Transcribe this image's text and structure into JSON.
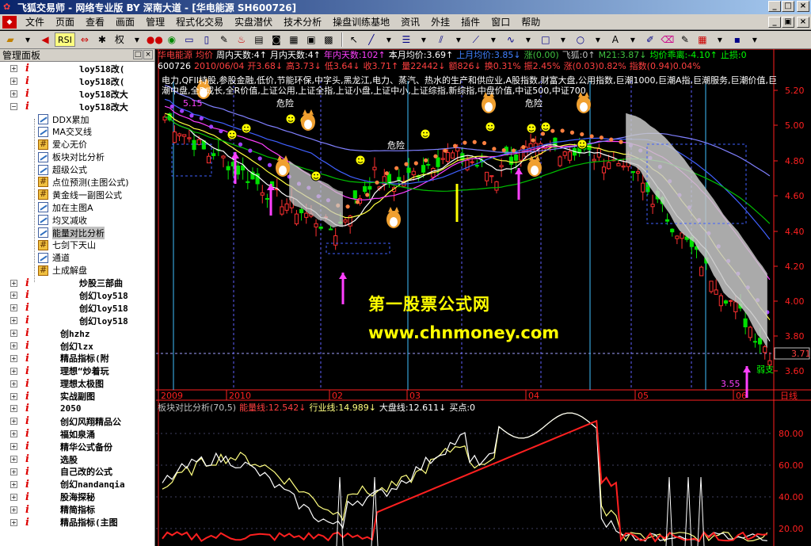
{
  "titlebar": {
    "title": "飞狐交易师 - 网络专业版 BY 深南大道 - [华电能源 SH600726]",
    "min": "_",
    "max": "□",
    "close": "×",
    "inner_min": "_",
    "inner_max": "▣",
    "inner_close": "×"
  },
  "menu": [
    "文件",
    "页面",
    "查看",
    "画面",
    "管理",
    "程式化交易",
    "实盘潜伏",
    "技术分析",
    "操盘训练基地",
    "资讯",
    "外挂",
    "插件",
    "窗口",
    "帮助"
  ],
  "toolbar": {
    "rsi_label": "RSI",
    "quan_label": "权"
  },
  "panel": {
    "title": "管理面板",
    "tree": [
      {
        "type": "folder",
        "label": "loy518改(",
        "expander": "+"
      },
      {
        "type": "folder",
        "label": "loy518改(",
        "expander": "+"
      },
      {
        "type": "folder",
        "label": "loy518改大",
        "expander": "+"
      },
      {
        "type": "folder",
        "label": "loy518改大",
        "expander": "−"
      },
      {
        "type": "child",
        "icon": "line",
        "label": "DDX累加"
      },
      {
        "type": "child",
        "icon": "line",
        "label": "MA交叉线"
      },
      {
        "type": "child",
        "icon": "grid",
        "label": "爱心无价"
      },
      {
        "type": "child",
        "icon": "line",
        "label": "板块对比分析"
      },
      {
        "type": "child",
        "icon": "line",
        "label": "超级公式"
      },
      {
        "type": "child",
        "icon": "grid",
        "label": "点位预测(主图公式)"
      },
      {
        "type": "child",
        "icon": "grid",
        "label": "黄金线一副图公式"
      },
      {
        "type": "child",
        "icon": "line",
        "label": "加在主图A"
      },
      {
        "type": "child",
        "icon": "line",
        "label": "均叉减收"
      },
      {
        "type": "child",
        "icon": "line",
        "label": "能量对比分析",
        "selected": true
      },
      {
        "type": "child",
        "icon": "grid",
        "label": "七剑下天山"
      },
      {
        "type": "child",
        "icon": "line",
        "label": "通道"
      },
      {
        "type": "child",
        "icon": "grid",
        "label": "土成解盘"
      },
      {
        "type": "folder",
        "label": "炒股三部曲",
        "expander": "+"
      },
      {
        "type": "folder",
        "label": "创幻loy518",
        "expander": "+"
      },
      {
        "type": "folder",
        "label": "创幻loy518",
        "expander": "+"
      },
      {
        "type": "folder",
        "label": "创幻loy518",
        "expander": "+"
      },
      {
        "type": "folder",
        "label": "创hzhz",
        "expander": "+"
      },
      {
        "type": "folder",
        "label": "创幻lzx",
        "expander": "+"
      },
      {
        "type": "folder",
        "label": "精品指标(附",
        "expander": "+"
      },
      {
        "type": "folder",
        "label": "理想“炒着玩",
        "expander": "+"
      },
      {
        "type": "folder",
        "label": "理想太极图",
        "expander": "+"
      },
      {
        "type": "folder",
        "label": "实战副图",
        "expander": "+"
      },
      {
        "type": "folder",
        "label": "2050",
        "expander": "+"
      },
      {
        "type": "folder",
        "label": "创幻风翔精品公",
        "expander": "+"
      },
      {
        "type": "folder",
        "label": "福如泉涌",
        "expander": "+"
      },
      {
        "type": "folder",
        "label": "精华公式备份",
        "expander": "+"
      },
      {
        "type": "folder",
        "label": "选股",
        "expander": "+"
      },
      {
        "type": "folder",
        "label": "自己改的公式",
        "expander": "+"
      },
      {
        "type": "folder",
        "label": "创幻nandanqia",
        "expander": "+"
      },
      {
        "type": "folder",
        "label": "股海探秘",
        "expander": "+"
      },
      {
        "type": "folder",
        "label": "精简指标",
        "expander": "+"
      },
      {
        "type": "folder",
        "label": "精品指标(主图",
        "expander": "+"
      }
    ]
  },
  "chart": {
    "header1": [
      {
        "text": "华电能源",
        "color": "#ff4040"
      },
      {
        "text": "均价",
        "color": "#ff4040"
      },
      {
        "text": "周内天数:4↑",
        "color": "#ffffff"
      },
      {
        "text": "月内天数:4↑",
        "color": "#ffffff"
      },
      {
        "text": "年内天数:102↑",
        "color": "#ff40ff"
      },
      {
        "text": "本月均价:3.69↑",
        "color": "#ffffff"
      },
      {
        "text": "上月均价:3.85↓",
        "color": "#4080ff"
      },
      {
        "text": "涨(0.00)",
        "color": "#40c040"
      },
      {
        "text": "飞狐:0↑",
        "color": "#c0c0c0"
      },
      {
        "text": "M21:3.87↓",
        "color": "#40c040"
      },
      {
        "text": "均价乖离:-4.10↑",
        "color": "#00ff00"
      },
      {
        "text": "止损:0",
        "color": "#00ff00"
      }
    ],
    "header2": [
      {
        "text": "600726",
        "color": "#ffffff"
      },
      {
        "text": "2010/06/04",
        "color": "#ff4040"
      },
      {
        "text": "开3.68↓",
        "color": "#ff4040"
      },
      {
        "text": "高3.73↓",
        "color": "#ff4040"
      },
      {
        "text": "低3.64↓",
        "color": "#ff4040"
      },
      {
        "text": "收3.71↑",
        "color": "#ff4040"
      },
      {
        "text": "量22442↓",
        "color": "#ff4040"
      },
      {
        "text": "额826↓",
        "color": "#ff4040"
      },
      {
        "text": "换0.31%",
        "color": "#ff4040"
      },
      {
        "text": "振2.45%",
        "color": "#ff4040"
      },
      {
        "text": "涨(0.03)0.82%",
        "color": "#ff4040"
      },
      {
        "text": "指数(0.94)0.04%",
        "color": "#ff4040"
      }
    ],
    "concepts": "电力,QFII持股,参股金融,低价,节能环保,中字头,黑龙江,电力、蒸汽、热水的生产和供应业,A股指数,财富大盘,公用指数,巨潮1000,巨潮A指,巨潮服务,巨潮价值,巨潮中盘,全R成长,全R价值,上证公用,上证全指,上证小盘,上证中小,上证综指,新综指,中盘价值,中证500,中证700",
    "price_axis": [
      "5.20",
      "5.00",
      "4.80",
      "4.60",
      "4.40",
      "4.20",
      "4.00",
      "3.80",
      "3.60"
    ],
    "current_price": "3.71",
    "annotations": {
      "high": "5.15",
      "low": "3.55",
      "weak": "弱支",
      "danger": "危险"
    },
    "time_labels": [
      "2009",
      "2010",
      "02",
      "03",
      "04",
      "05",
      "06"
    ],
    "period_label": "日线",
    "indicator_header": [
      {
        "text": "板块对比分析(70,5)",
        "color": "#c0c0c0"
      },
      {
        "text": "能量线:12.542↓",
        "color": "#ff4040"
      },
      {
        "text": "行业线:14.989↓",
        "color": "#ffff80"
      },
      {
        "text": "大盘线:12.611↓",
        "color": "#ffffff"
      },
      {
        "text": "买点:0",
        "color": "#ffffff"
      }
    ],
    "indicator_axis": [
      "80.00",
      "60.00",
      "40.00",
      "20.00"
    ]
  },
  "watermark": {
    "line1": "第一股票公式网",
    "line2": "www.chnmoney.com"
  },
  "colors": {
    "up": "#ff3030",
    "down": "#00ff00",
    "bg": "#000000",
    "axis": "#ff2020",
    "accent": "#ff40ff"
  }
}
